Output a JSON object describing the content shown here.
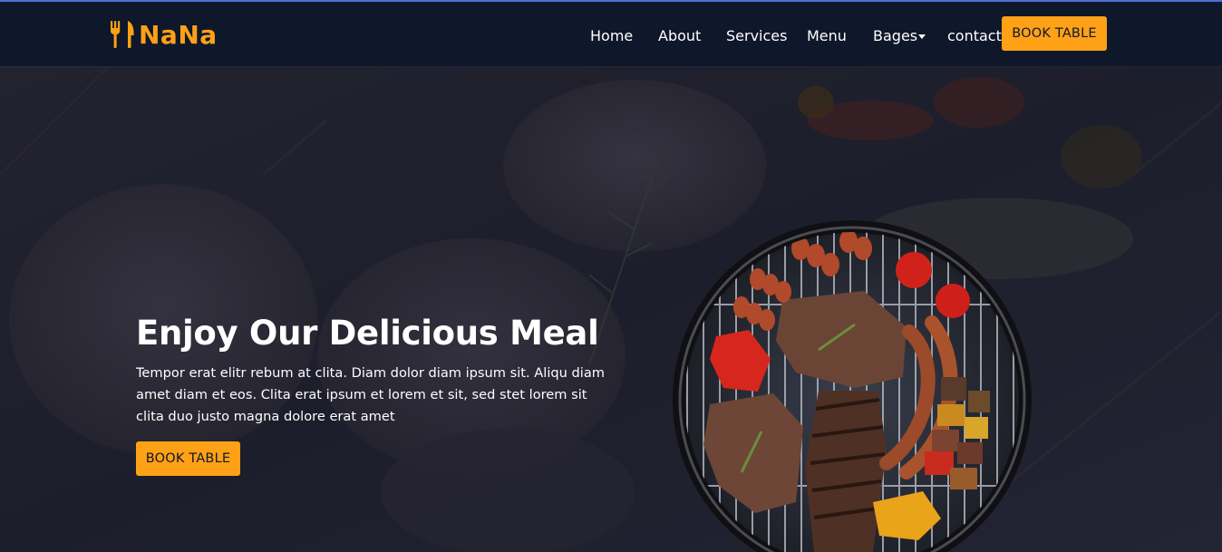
{
  "brand": {
    "name": "NaNa",
    "icon": "utensils-icon",
    "color": "#fea116"
  },
  "nav": {
    "items": [
      {
        "label": "Home"
      },
      {
        "label": "About"
      },
      {
        "label": "Services"
      },
      {
        "label": "Menu"
      },
      {
        "label": "Bages",
        "dropdown": true
      },
      {
        "label": "contact"
      }
    ],
    "cta_label": "BOOK TABLE"
  },
  "hero": {
    "title": "Enjoy Our Delicious Meal",
    "text": "Tempor erat elitr rebum at clita. Diam dolor diam ipsum sit. Aliqu diam amet diam et eos. Clita erat ipsum et lorem et sit, sed stet lorem sit clita duo justo magna dolore erat amet",
    "button_label": "BOOK TABLE",
    "image": "grill-with-meat"
  },
  "colors": {
    "dark": "#0f172b",
    "accent": "#fea116",
    "text": "#ffffff"
  }
}
